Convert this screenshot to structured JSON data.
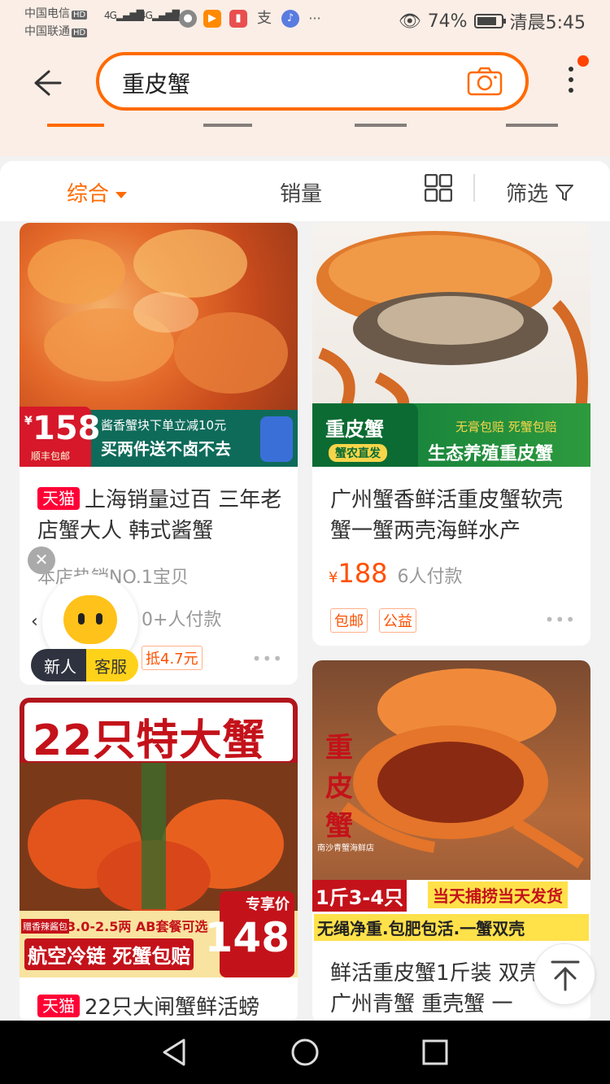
{
  "status_bar": {
    "carrier1": "中国电信",
    "carrier2": "中国联通",
    "hd": "HD",
    "net1": "4G",
    "net2": "4G",
    "battery": "74%",
    "time": "清晨5:45",
    "more": "···",
    "app_icons": [
      "wechat-icon",
      "video-icon",
      "book-icon",
      "alipay-icon",
      "music-icon"
    ]
  },
  "search": {
    "query": "重皮蟹",
    "back_icon": "back-arrow-icon",
    "camera_icon": "camera-icon",
    "more_icon": "more-vertical-icon"
  },
  "sort": {
    "comprehensive": "综合",
    "sales": "销量",
    "filter": "筛选"
  },
  "products": [
    {
      "image_text": {
        "price": "158",
        "price_note": "顺丰包邮",
        "promo1": "酱香蟹块下单立减10元",
        "promo2": "买两件送不卤不去"
      },
      "tmall": "天猫",
      "title": "上海销量过百 三年老店蟹大人 韩式酱蟹",
      "subtitle": "本店热销NO.1宝贝",
      "buyers": "0+人付款",
      "coupon": "抵4.7元"
    },
    {
      "image_text": {
        "brand": "重皮蟹",
        "badge": "蟹农直发",
        "promo1": "无膏包赔 死蟹包赔",
        "promo2": "生态养殖重皮蟹"
      },
      "title": "广州蟹香鲜活重皮蟹软壳蟹一蟹两壳海鲜水产",
      "price": "188",
      "currency": "¥",
      "buyers": "6人付款",
      "tags": [
        "包邮",
        "公益"
      ]
    },
    {
      "image_text": {
        "headline": "22只特大蟹",
        "sauce": "赠香辣酱包",
        "spec": "3.0-2.5两 AB套餐可选",
        "promo": "航空冷链 死蟹包赔",
        "price_label": "专享价",
        "price": "148"
      },
      "tmall": "天猫",
      "title": "22只大闸蟹鲜活螃"
    },
    {
      "image_text": {
        "vertical": "重皮蟹",
        "shop": "南沙青蟹海鲜店",
        "spec": "1斤3-4只",
        "promo1": "当天捕捞当天发货",
        "promo2": "无绳净重.包肥包活.一蟹双壳"
      },
      "title": "鲜活重皮蟹1斤装 双壳蟹 广州青蟹 重壳蟹 一"
    }
  ],
  "float_widget": {
    "new_user": "新人",
    "service": "客服",
    "close": "✕",
    "arrow": "‹"
  },
  "colors": {
    "accent": "#ff6a00",
    "price": "#ff5000",
    "tmall": "#ff0036"
  }
}
